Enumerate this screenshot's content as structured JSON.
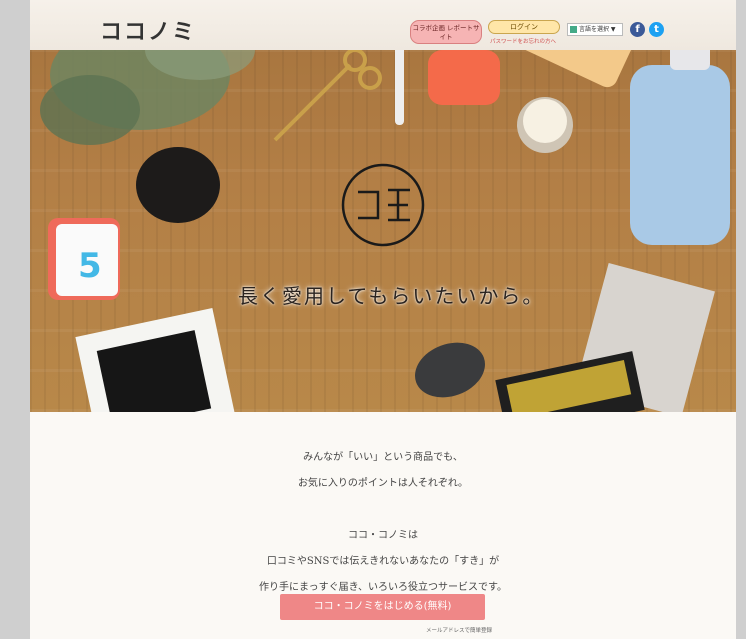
{
  "header": {
    "logo_text": "ココノミ",
    "collab_button_label": "コラボ企画 レポートサイト",
    "login_button_label": "ログイン",
    "password_link": "パスワードをお忘れの方へ",
    "language_select": "言語を選択 ▼"
  },
  "hero": {
    "tagline": "長く愛用してもらいたいから。"
  },
  "intro": {
    "lines": [
      "みんなが「いい」という商品でも、",
      "お気に入りのポイントは人それぞれ。",
      "",
      "ココ・コノミは",
      "口コミやSNSでは伝えきれないあなたの「すき」が",
      "作り手にまっすぐ届き、いろいろ役立つサービスです。"
    ]
  },
  "cta": {
    "button_label": "ココ・コノミをはじめる(無料)",
    "sub_link": "メールアドレスで簡単登録"
  },
  "colors": {
    "accent": "#ef8787",
    "login": "#ffe6a8",
    "facebook": "#3b5998",
    "twitter": "#1da1f2"
  }
}
